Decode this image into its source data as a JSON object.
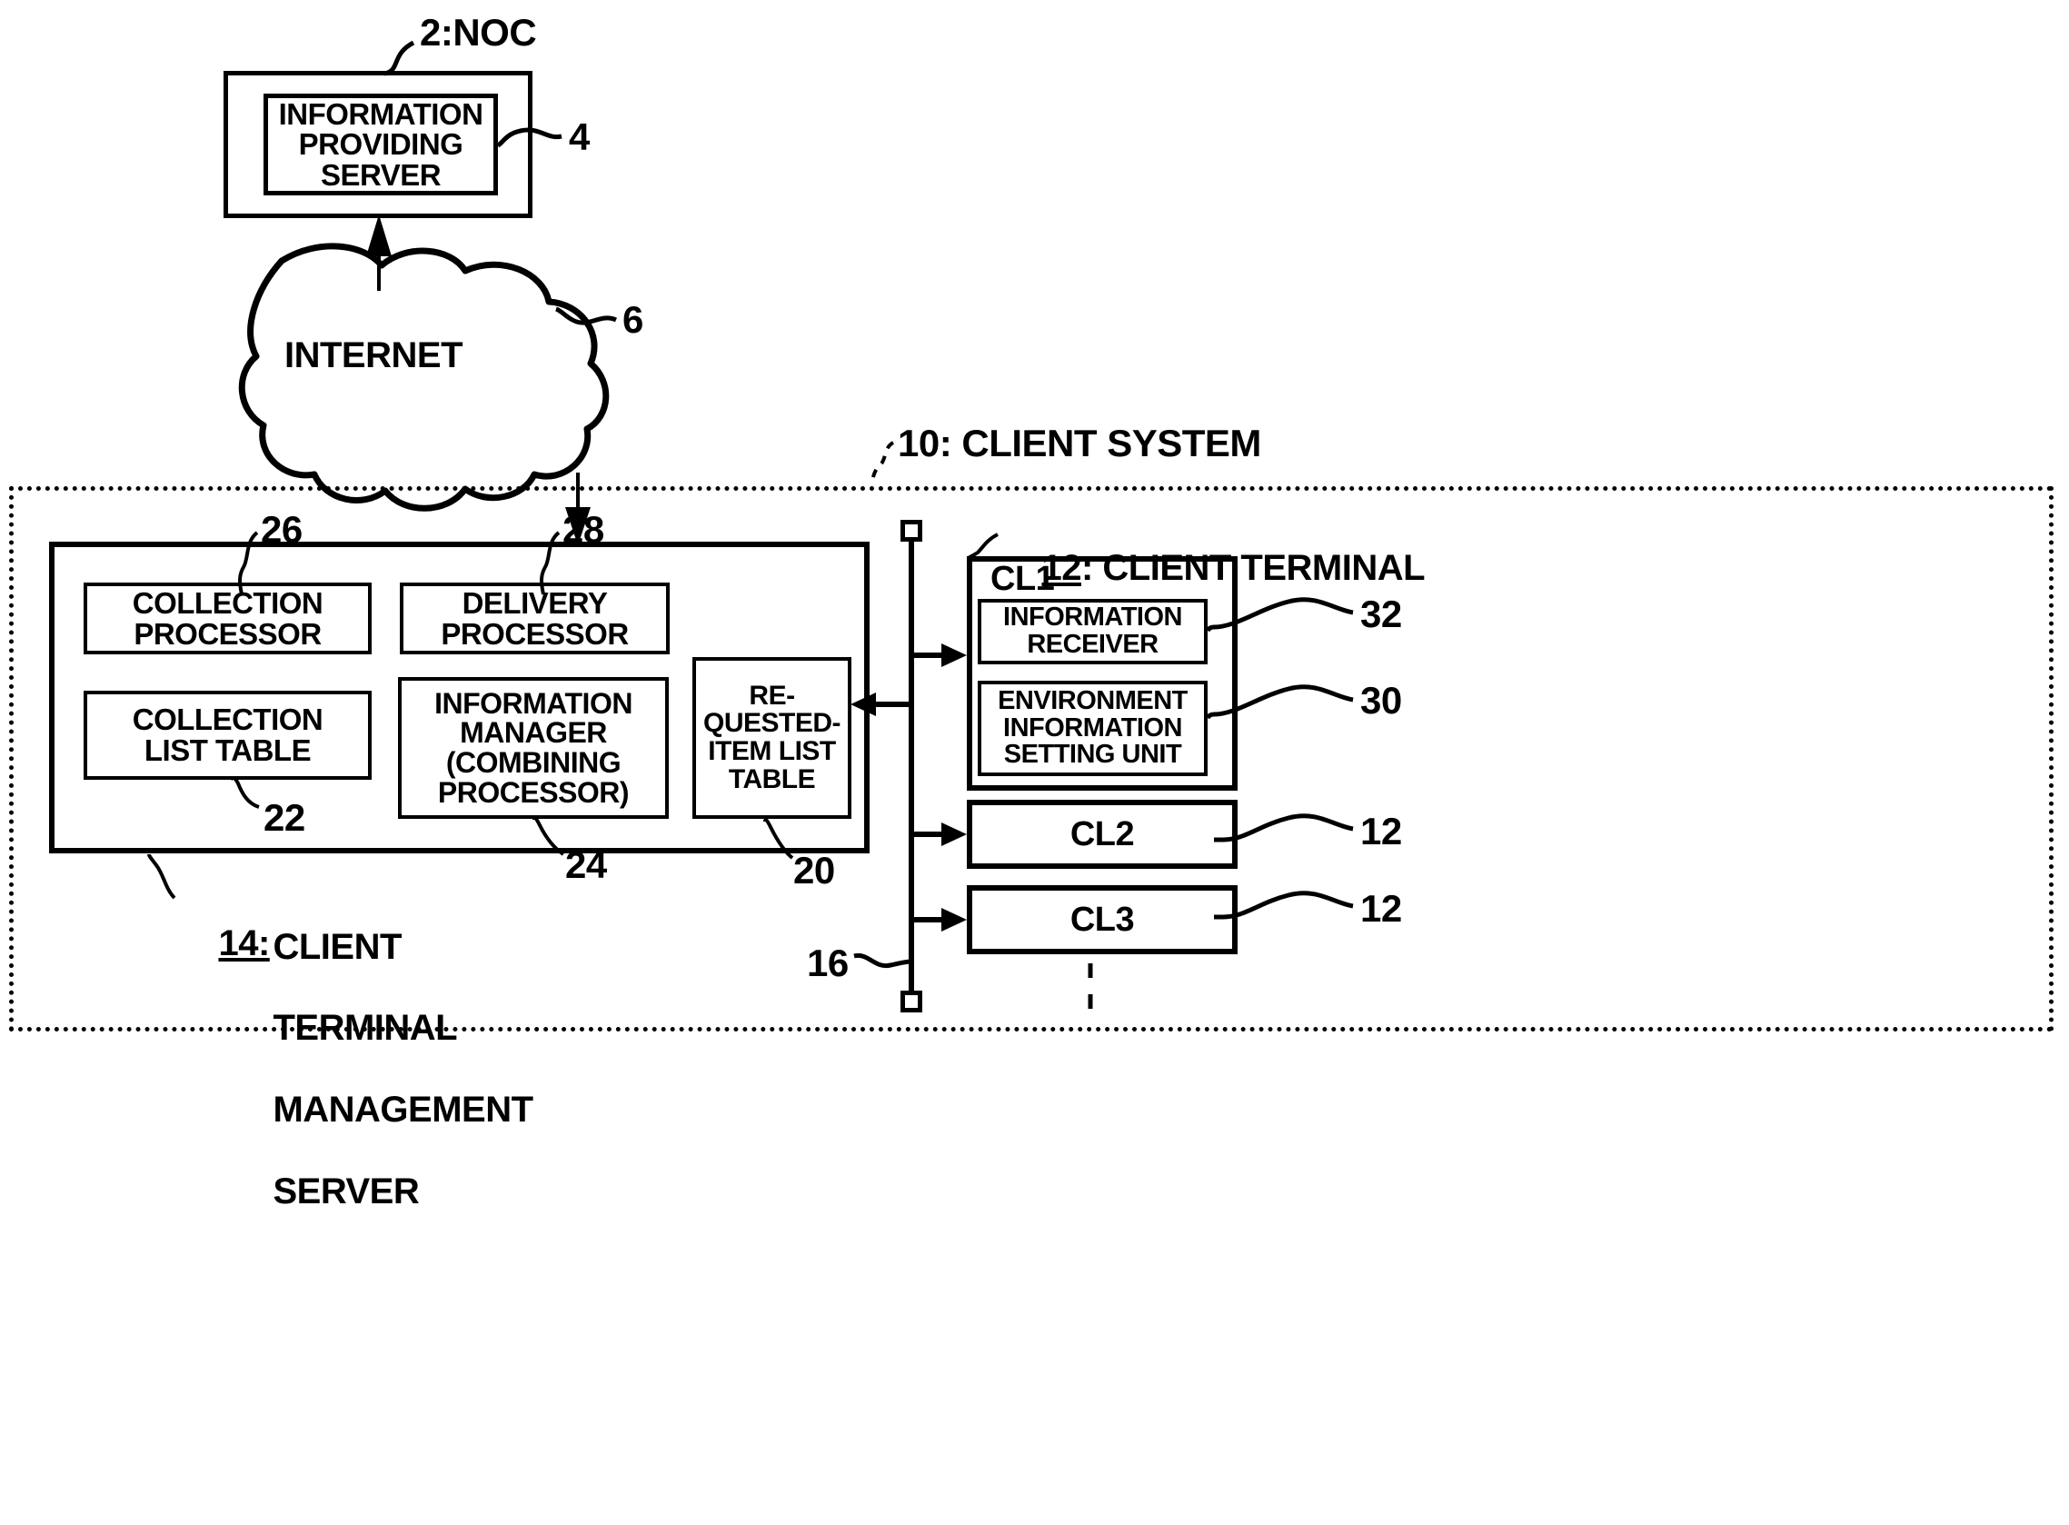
{
  "figure": {
    "type": "patent-block-diagram",
    "background": "#ffffff",
    "line_color": "#000000"
  },
  "noc": {
    "ref_label": "2:NOC",
    "server": {
      "ref_label": "4",
      "title_line1": "INFORMATION",
      "title_line2": "PROVIDING",
      "title_line3": "SERVER"
    }
  },
  "network": {
    "cloud_label": "INTERNET",
    "ref_label": "6"
  },
  "client_system": {
    "ref_label": "10: CLIENT SYSTEM"
  },
  "management_server": {
    "ref_label_number": "14:",
    "ref_label_text_line1": "CLIENT",
    "ref_label_text_line2": "TERMINAL",
    "ref_label_text_line3": "MANAGEMENT",
    "ref_label_text_line4": "SERVER",
    "blocks": [
      {
        "ref": "26",
        "line1": "COLLECTION",
        "line2": "PROCESSOR"
      },
      {
        "ref": "28",
        "line1": "DELIVERY",
        "line2": "PROCESSOR"
      },
      {
        "ref": "22",
        "line1": "COLLECTION",
        "line2": "LIST TABLE"
      },
      {
        "ref": "24",
        "line1": "INFORMATION",
        "line2": "MANAGER",
        "line3": "(COMBINING",
        "line4": "PROCESSOR)"
      },
      {
        "ref": "20",
        "line1": "RE-",
        "line2": "QUESTED-",
        "line3": "ITEM LIST",
        "line4": "TABLE"
      }
    ]
  },
  "bus": {
    "ref_label": "16"
  },
  "client_terminal": {
    "ref_label": "12: CLIENT TERMINAL",
    "cl1": {
      "name": "CL1",
      "receiver": {
        "ref": "32",
        "line1": "INFORMATION",
        "line2": "RECEIVER"
      },
      "env_setting": {
        "ref": "30",
        "line1": "ENVIRONMENT",
        "line2": "INFORMATION",
        "line3": "SETTING UNIT"
      }
    },
    "cl2": {
      "name": "CL2",
      "ref": "12"
    },
    "cl3": {
      "name": "CL3",
      "ref": "12"
    }
  }
}
